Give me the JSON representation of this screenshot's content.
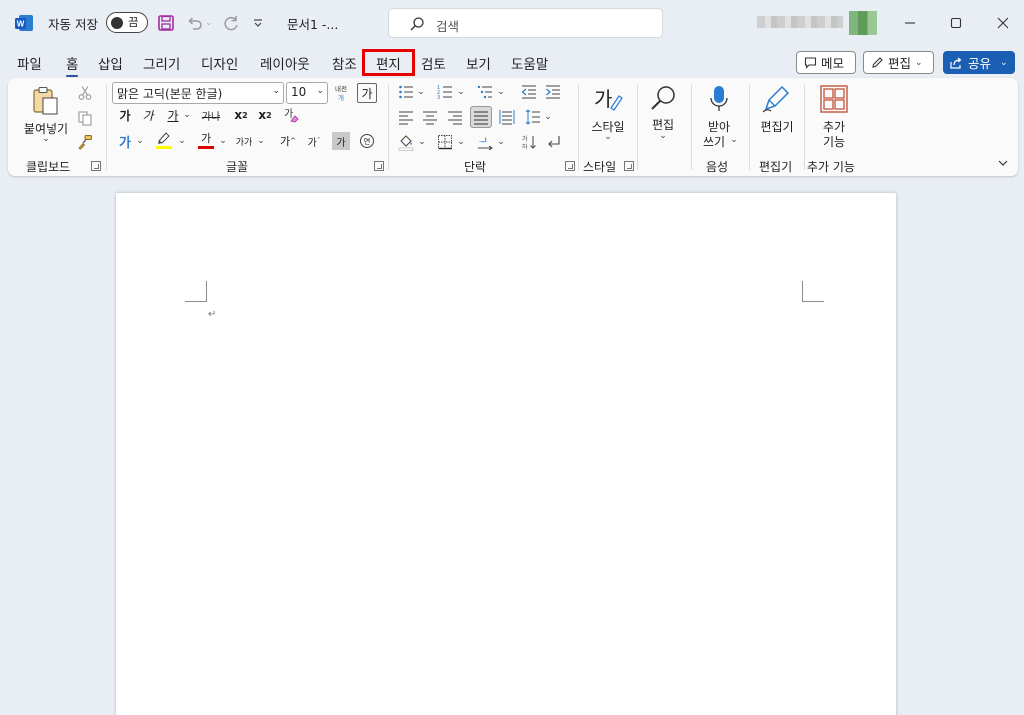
{
  "titlebar": {
    "autosave_label": "자동 저장",
    "autosave_state": "끔",
    "document_name": "문서1  -...",
    "search_placeholder": "검색"
  },
  "tabs": [
    "파일",
    "홈",
    "삽입",
    "그리기",
    "디자인",
    "레이아웃",
    "참조",
    "편지",
    "검토",
    "보기",
    "도움말"
  ],
  "active_tab": "홈",
  "highlighted_tab": "편지",
  "right_buttons": {
    "memo": "메모",
    "edit": "편집",
    "share": "공유"
  },
  "ribbon": {
    "clipboard": {
      "paste_label": "붙여넣기",
      "group_label": "클립보드"
    },
    "font": {
      "font_name": "맑은 고딕(본문 한글)",
      "font_size": "10",
      "group_label": "글꼴"
    },
    "paragraph": {
      "group_label": "단락"
    },
    "styles": {
      "button_label": "스타일",
      "group_label": "스타일"
    },
    "editing": {
      "button_label": "편집"
    },
    "voice": {
      "button_label_1": "받아",
      "button_label_2": "쓰기",
      "group_label": "음성"
    },
    "editor": {
      "button_label": "편집기",
      "group_label": "편집기"
    },
    "addins": {
      "button_label_1": "추가",
      "button_label_2": "기능",
      "group_label": "추가 기능"
    }
  },
  "colors": {
    "accent": "#2b579a",
    "share_button": "#1a5fb4",
    "highlight_box": "#e60000",
    "text_highlight": "#ffff00",
    "font_color": "#e00000"
  }
}
